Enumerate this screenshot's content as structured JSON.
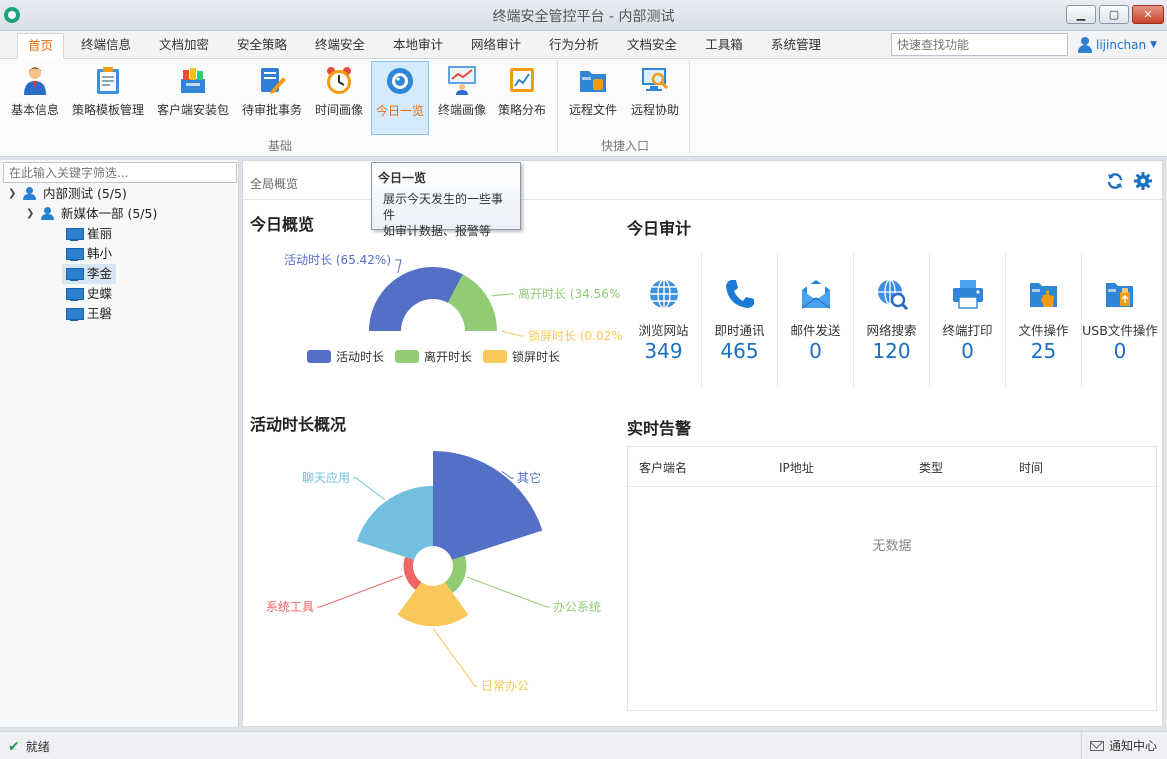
{
  "window": {
    "title": "终端安全管控平台 - 内部测试"
  },
  "menu": {
    "tabs": [
      "首页",
      "终端信息",
      "文档加密",
      "安全策略",
      "终端安全",
      "本地审计",
      "网络审计",
      "行为分析",
      "文档安全",
      "工具箱",
      "系统管理"
    ],
    "active": "首页",
    "search_placeholder": "快速查找功能",
    "user": "lijinchan"
  },
  "ribbon": {
    "buttons": [
      "基本信息",
      "策略模板管理",
      "客户端安装包",
      "待审批事务",
      "时间画像",
      "今日一览",
      "终端画像",
      "策略分布",
      "远程文件",
      "远程协助"
    ],
    "active": "今日一览",
    "groups": [
      "基础",
      "快捷入口"
    ]
  },
  "tooltip": {
    "title": "今日一览",
    "lines": [
      "展示今天发生的一些事件",
      "如审计数据、报警等"
    ]
  },
  "tree": {
    "filter_placeholder": "在此输入关键字筛选...",
    "root": "内部测试 (5/5)",
    "dept": "新媒体一部 (5/5)",
    "users": [
      "崔丽",
      "韩小",
      "李金",
      "史蝶",
      "王磐"
    ],
    "selected": "李金"
  },
  "main": {
    "breadcrumb": "全局概览",
    "overview_title": "今日概览",
    "audit_title": "今日审计",
    "activity_title": "活动时长概况",
    "alert_title": "实时告警"
  },
  "audit": [
    {
      "label": "浏览网站",
      "value": "349",
      "icon": "globe-icon"
    },
    {
      "label": "即时通讯",
      "value": "465",
      "icon": "phone-icon"
    },
    {
      "label": "邮件发送",
      "value": "0",
      "icon": "mail-icon"
    },
    {
      "label": "网络搜索",
      "value": "120",
      "icon": "globe-search-icon"
    },
    {
      "label": "终端打印",
      "value": "0",
      "icon": "printer-icon"
    },
    {
      "label": "文件操作",
      "value": "25",
      "icon": "folder-hand-icon"
    },
    {
      "label": "USB文件操作",
      "value": "0",
      "icon": "usb-folder-icon"
    }
  ],
  "alerts": {
    "columns": [
      "客户端名",
      "IP地址",
      "类型",
      "时间"
    ],
    "empty_text": "无数据"
  },
  "status": {
    "text": "就绪",
    "notify": "通知中心"
  },
  "colors": {
    "blue": "#5470c6",
    "green": "#91cc75",
    "yellow": "#fac858",
    "red": "#ee6666",
    "cyan": "#73c0de",
    "accent": "#e66b11"
  },
  "chart_data": [
    {
      "type": "pie",
      "subtype": "half-donut",
      "series": [
        {
          "name": "活动时长",
          "value": 65.42,
          "label": "活动时长 (65.42%)"
        },
        {
          "name": "离开时长",
          "value": 34.56,
          "label": "离开时长 (34.56%"
        },
        {
          "name": "锁屏时长",
          "value": 0.02,
          "label": "锁屏时长 (0.02%"
        }
      ],
      "legend": [
        "活动时长",
        "离开时长",
        "锁屏时长"
      ],
      "legend_position": "bottom"
    },
    {
      "type": "pie",
      "subtype": "nightingale-rose",
      "series": [
        {
          "name": "其它",
          "value": 100
        },
        {
          "name": "办公系统",
          "value": 2
        },
        {
          "name": "日常办公",
          "value": 18
        },
        {
          "name": "系统工具",
          "value": 1
        },
        {
          "name": "聊天应用",
          "value": 40
        }
      ]
    }
  ]
}
